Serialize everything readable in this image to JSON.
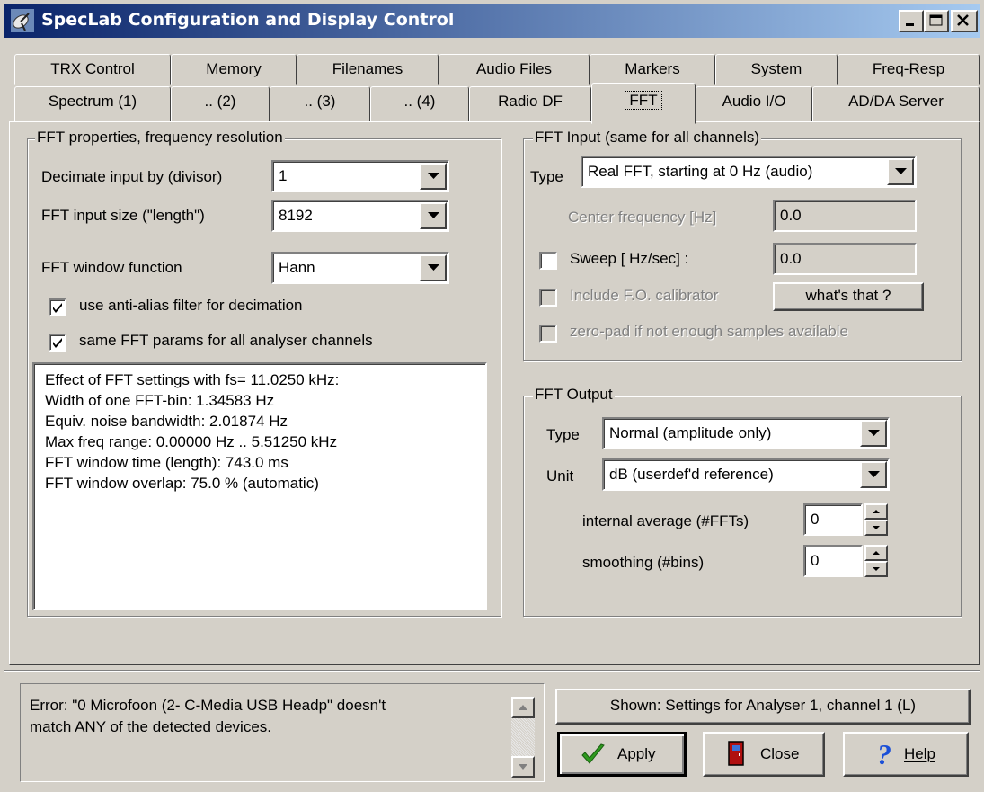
{
  "window": {
    "title": "SpecLab  Configuration and Display Control"
  },
  "tabs": {
    "row1": [
      "TRX Control",
      "Memory",
      "Filenames",
      "Audio Files",
      "Markers",
      "System",
      "Freq-Resp"
    ],
    "row2": [
      "Spectrum (1)",
      ".. (2)",
      ".. (3)",
      ".. (4)",
      "Radio DF",
      "FFT",
      "Audio I/O",
      "AD/DA Server"
    ]
  },
  "fft_props": {
    "legend": "FFT properties, frequency resolution",
    "decimate_label": "Decimate input by (divisor)",
    "decimate_value": "1",
    "size_label": "FFT input size (\"length\")",
    "size_value": "8192",
    "window_label": "FFT window function",
    "window_value": "Hann",
    "antialias_label": "use anti-alias filter for decimation",
    "antialias_checked": true,
    "sameparams_label": "same FFT params for all analyser channels",
    "sameparams_checked": true,
    "info_lines": [
      "Effect of FFT settings with fs= 11.0250 kHz:",
      "Width of one FFT-bin: 1.34583 Hz",
      "Equiv. noise bandwidth: 2.01874 Hz",
      "Max freq range: 0.00000 Hz .. 5.51250 kHz",
      "FFT window time (length): 743.0 ms",
      "FFT window overlap: 75.0 % (automatic)"
    ]
  },
  "fft_input": {
    "legend": "FFT Input (same for all channels)",
    "type_label": "Type",
    "type_value": "Real FFT, starting at 0 Hz (audio)",
    "center_label": "Center frequency [Hz]",
    "center_value": "0.0",
    "sweep_label": "Sweep [ Hz/sec] :",
    "sweep_value": "0.0",
    "include_fo_label": "Include F.O. calibrator",
    "whats_that_label": "what's that ?",
    "zeropad_label": "zero-pad if not enough samples available"
  },
  "fft_output": {
    "legend": "FFT Output",
    "type_label": "Type",
    "type_value": "Normal (amplitude only)",
    "unit_label": "Unit",
    "unit_value": "dB (userdef'd reference)",
    "avg_label": "internal average (#FFTs)",
    "avg_value": "0",
    "smooth_label": "smoothing (#bins)",
    "smooth_value": "0"
  },
  "status": {
    "error_line1": "Error: \"0 Microfoon (2- C-Media USB Headp\" doesn't",
    "error_line2": "match ANY of the detected devices.",
    "shown_label": "Shown: Settings for Analyser 1, channel 1 (L)"
  },
  "buttons": {
    "apply": "Apply",
    "close": "Close",
    "help": "Help"
  },
  "icons": {
    "app": "satellite-dish-icon",
    "apply": "checkmark-icon",
    "close": "door-icon",
    "help": "question-mark-icon"
  },
  "colors": {
    "title_start": "#0a246a",
    "title_end": "#a6caf0",
    "face": "#d4d0c8",
    "apply_check": "#2e9a1e",
    "help_blue": "#1a4fd8",
    "door_red": "#b01010"
  }
}
